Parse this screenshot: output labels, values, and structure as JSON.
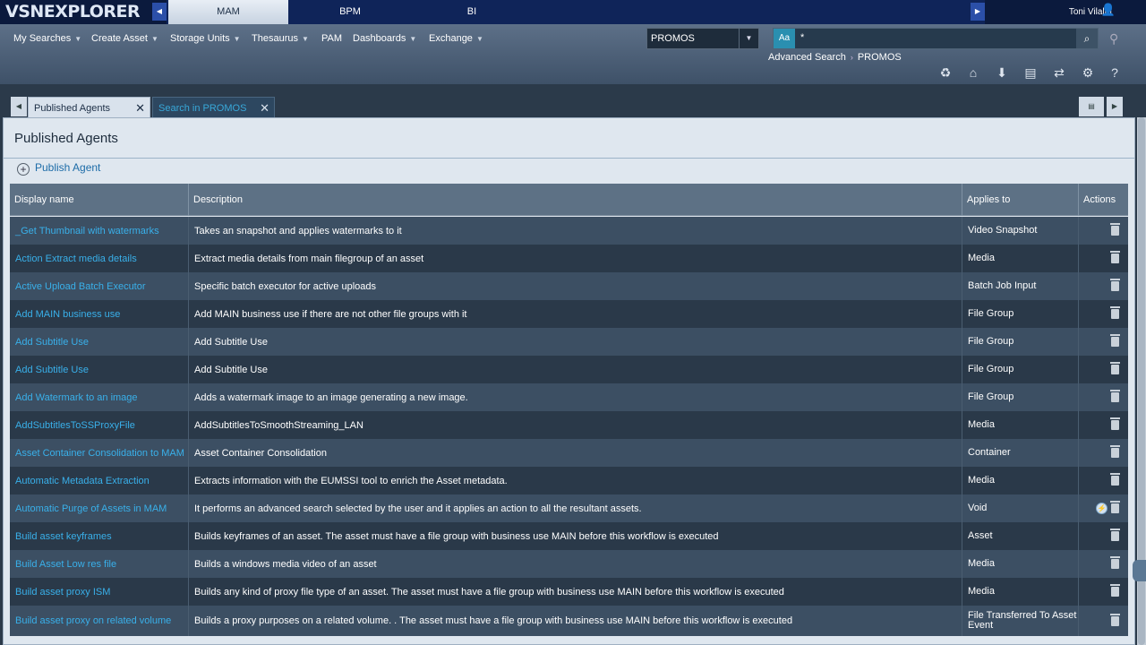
{
  "app": {
    "logo": "VSNEXPLORER",
    "tabs": [
      "MAM",
      "BPM",
      "BI"
    ],
    "user": "Toni Vilalta"
  },
  "menu": {
    "items": [
      "My Searches",
      "Create Asset",
      "Storage Units",
      "Thesaurus",
      "PAM",
      "Dashboards",
      "Exchange"
    ],
    "scope_select": "PROMOS",
    "search_mode": "Aa",
    "search_value": "*",
    "advanced_search": "Advanced Search",
    "breadcrumb_current": "PROMOS"
  },
  "content_tabs": [
    {
      "label": "Published Agents",
      "active": true
    },
    {
      "label": "Search in PROMOS",
      "active": false
    }
  ],
  "panel": {
    "title": "Published Agents",
    "publish_label": "Publish Agent"
  },
  "table": {
    "headers": [
      "Display name",
      "Description",
      "Applies to",
      "Actions"
    ],
    "rows": [
      {
        "name": "_Get Thumbnail with watermarks",
        "description": "Takes an snapshot and applies watermarks to it",
        "applies": "Video Snapshot",
        "run": false
      },
      {
        "name": "Action Extract media details",
        "description": "Extract media details from main filegroup of an asset",
        "applies": "Media",
        "run": false
      },
      {
        "name": "Active Upload Batch Executor",
        "description": "Specific batch executor for active uploads",
        "applies": "Batch Job Input",
        "run": false
      },
      {
        "name": "Add MAIN business use",
        "description": "Add MAIN business use if there are not other file groups with it",
        "applies": "File Group",
        "run": false
      },
      {
        "name": "Add Subtitle Use",
        "description": "Add Subtitle Use",
        "applies": "File Group",
        "run": false
      },
      {
        "name": "Add Subtitle Use",
        "description": "Add Subtitle Use",
        "applies": "File Group",
        "run": false
      },
      {
        "name": "Add Watermark to an image",
        "description": "Adds a watermark image to an image generating a new image.",
        "applies": "File Group",
        "run": false
      },
      {
        "name": "AddSubtitlesToSSProxyFile",
        "description": "AddSubtitlesToSmoothStreaming_LAN",
        "applies": "Media",
        "run": false
      },
      {
        "name": "Asset Container Consolidation to MAM",
        "description": "Asset Container Consolidation",
        "applies": "Container",
        "run": false
      },
      {
        "name": "Automatic Metadata Extraction",
        "description": "Extracts information with the EUMSSI tool to enrich the Asset metadata.",
        "applies": "Media",
        "run": false
      },
      {
        "name": "Automatic Purge of Assets in MAM",
        "description": "It performs an advanced search selected by the user and it applies an action to all the resultant assets.",
        "applies": "Void",
        "run": true
      },
      {
        "name": "Build asset keyframes",
        "description": "Builds keyframes of an asset. The asset must have a file group with business use MAIN before this workflow is executed",
        "applies": "Asset",
        "run": false
      },
      {
        "name": "Build Asset Low res file",
        "description": "Builds a windows media video of an asset",
        "applies": "Media",
        "run": false
      },
      {
        "name": "Build asset proxy ISM",
        "description": "Builds any kind of proxy file type of an asset. The asset must have a file group with business use MAIN before this workflow is executed",
        "applies": "Media",
        "run": false
      },
      {
        "name": "Build asset proxy on related volume",
        "description": "Builds a proxy purposes on a related volume. . The asset must have a file group with business use MAIN before this workflow is executed",
        "applies": "File Transferred To Asset Event",
        "run": false
      }
    ]
  }
}
